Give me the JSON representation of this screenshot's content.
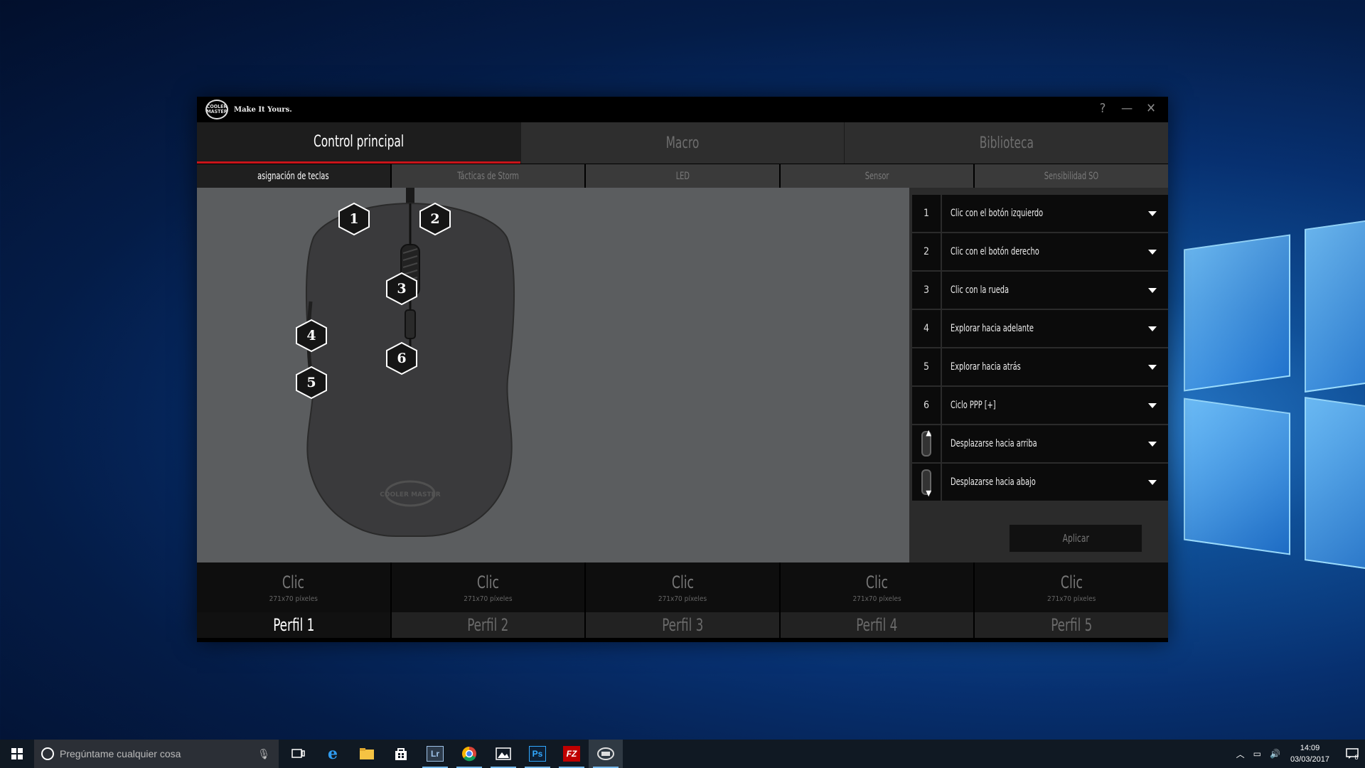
{
  "app": {
    "brand_logo": "cooler-master-logo",
    "brand_logo_text": "COOLER MASTER",
    "tagline": "Make It Yours.",
    "controls": {
      "help": "?",
      "minimize": "—",
      "close": "✕"
    }
  },
  "main_tabs": [
    {
      "label": "Control principal",
      "active": true
    },
    {
      "label": "Macro",
      "active": false
    },
    {
      "label": "Biblioteca",
      "active": false
    }
  ],
  "sub_tabs": [
    {
      "label": "asignación de teclas",
      "active": true
    },
    {
      "label": "Tácticas de Storm",
      "active": false
    },
    {
      "label": "LED",
      "active": false
    },
    {
      "label": "Sensor",
      "active": false
    },
    {
      "label": "Sensibilidad SO",
      "active": false
    }
  ],
  "mouse": {
    "buttons": [
      "1",
      "2",
      "3",
      "4",
      "5",
      "6"
    ],
    "logo_text": "COOLER MASTER"
  },
  "assignments": [
    {
      "num": "1",
      "label": "Clic con el botón izquierdo"
    },
    {
      "num": "2",
      "label": "Clic con el botón derecho"
    },
    {
      "num": "3",
      "label": "Clic con la rueda"
    },
    {
      "num": "4",
      "label": "Explorar hacia adelante"
    },
    {
      "num": "5",
      "label": "Explorar hacia atrás"
    },
    {
      "num": "6",
      "label": "Ciclo PPP [+]"
    },
    {
      "num": "",
      "icon": "scroll-up-icon",
      "label": "Desplazarse hacia arriba"
    },
    {
      "num": "",
      "icon": "scroll-down-icon",
      "label": "Desplazarse hacia abajo"
    }
  ],
  "apply_label": "Aplicar",
  "profiles": [
    {
      "image_label": "Clic",
      "size": "271x70 píxeles",
      "name": "Perfil 1",
      "active": true
    },
    {
      "image_label": "Clic",
      "size": "271x70 píxeles",
      "name": "Perfil 2",
      "active": false
    },
    {
      "image_label": "Clic",
      "size": "271x70 píxeles",
      "name": "Perfil 3",
      "active": false
    },
    {
      "image_label": "Clic",
      "size": "271x70 píxeles",
      "name": "Perfil 4",
      "active": false
    },
    {
      "image_label": "Clic",
      "size": "271x70 píxeles",
      "name": "Perfil 5",
      "active": false
    }
  ],
  "taskbar": {
    "search_placeholder": "Pregúntame cualquier cosa",
    "apps": [
      "task-view-icon",
      "edge-icon",
      "file-explorer-icon",
      "store-icon",
      "lightroom-icon",
      "chrome-icon",
      "photos-icon",
      "photoshop-icon",
      "filezilla-icon",
      "cooler-master-app-icon"
    ],
    "app_labels": {
      "lightroom": "Lr",
      "photoshop": "Ps",
      "filezilla": "FZ"
    },
    "time": "14:09",
    "date": "03/03/2017",
    "notification_count": "8"
  },
  "colors": {
    "accent_red": "#c8141a",
    "canvas_gray": "#5b5d5f",
    "panel_dark": "#2b2b2b"
  }
}
